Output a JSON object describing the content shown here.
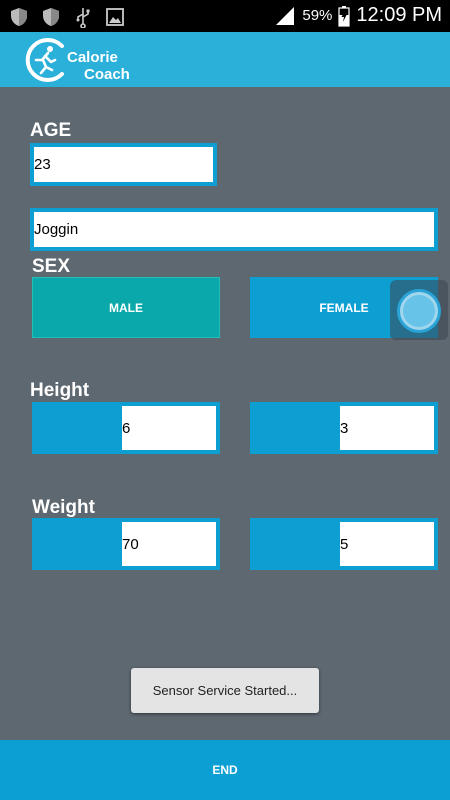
{
  "status_bar": {
    "battery_percent": "59%",
    "time": "12:09 PM",
    "icons": [
      "shield-icon",
      "shield-icon",
      "usb-icon",
      "image-icon",
      "signal-icon",
      "battery-charging-icon"
    ]
  },
  "app": {
    "logo_line1": "Calorie",
    "logo_line2": "Coach"
  },
  "form": {
    "age_label": "AGE",
    "age_value": "23",
    "activity_value": "Joggin",
    "sex_label": "SEX",
    "male_label": "MALE",
    "female_label": "FEMALE",
    "height_label": "Height",
    "height_value_1": "6",
    "height_value_2": "3",
    "weight_label": "Weight",
    "weight_value_1": "70",
    "weight_value_2": "5"
  },
  "toast": {
    "message": "Sensor Service Started..."
  },
  "footer": {
    "end_label": "END"
  },
  "colors": {
    "background": "#5e6871",
    "app_bar": "#2bb0d9",
    "accent_blue": "#0d9fd2",
    "male_teal": "#0ba8ab"
  }
}
